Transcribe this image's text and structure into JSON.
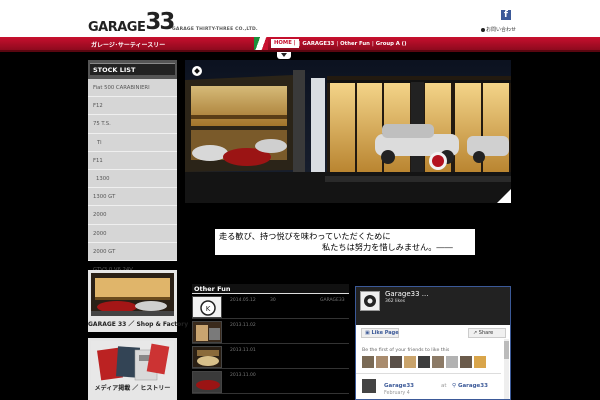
{
  "header": {
    "logo_word": "GARAGE",
    "logo_number": "33",
    "company": "GARAGE THIRTY-THREE CO.,LTD.",
    "facebook_icon": "facebook-icon",
    "contact_label": "お問い合わせ",
    "kana_title": "ガレージ･サーティースリー"
  },
  "nav": {
    "home": "HOME",
    "garage33": "GARAGE33",
    "other_fun": "Other Fun",
    "group_a": "Group A ()"
  },
  "stock_list": {
    "title": "STOCK LIST",
    "items": [
      "Fiat 500 CARABINIERI",
      "F12",
      "75 T.S.",
      "Ti",
      "F11",
      "1300",
      "1300 GT",
      "2000",
      "2000",
      "2000 GT",
      "GTV3.0 V6 24V"
    ]
  },
  "tagline": {
    "line1": "走る歓び、持つ悦びを味わっていただくために",
    "line2": "私たちは努力を惜しみません。――"
  },
  "banners": {
    "shop": "GARAGE 33 ／ Shop & Factory",
    "media": "メディア掲載 ／ ヒストリー"
  },
  "other_fun": {
    "title": "Other Fun",
    "rows": [
      {
        "date": "2014.05.12",
        "extra": "30",
        "extra2": "GARAGE33"
      },
      {
        "date": "2013.11.02"
      },
      {
        "date": "2013.11.01"
      },
      {
        "date": "2013.11.00"
      }
    ]
  },
  "facebook": {
    "page_name": "Garage33 ...",
    "likes": "362 likes",
    "like_button": "Like Page",
    "share_button": "Share",
    "first_friends": "Be the first of your friends to like this",
    "post_name": "Garage33",
    "post_at": "at",
    "post_place": "Garage33",
    "post_date": "February 4"
  },
  "colors": {
    "accent_red": "#c8102e",
    "facebook_blue": "#3b5998"
  }
}
